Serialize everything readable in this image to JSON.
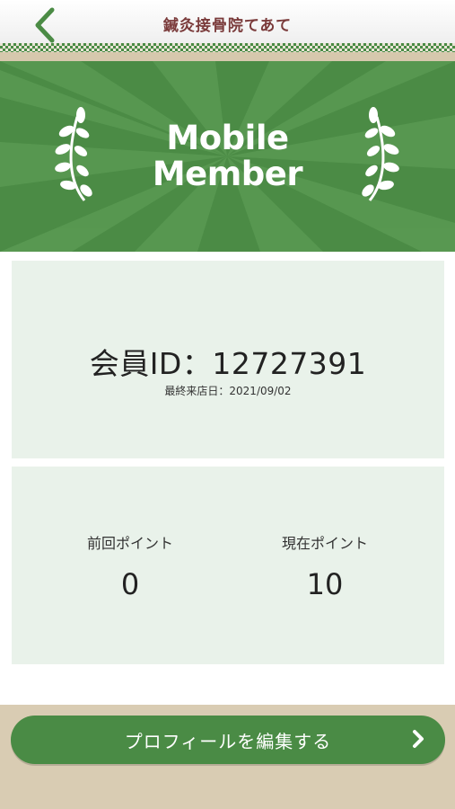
{
  "header": {
    "title": "鍼灸接骨院てあて",
    "back_icon": "chevron-left-icon"
  },
  "banner": {
    "line1": "Mobile",
    "line2": "Member",
    "left_icon": "laurel-icon",
    "right_icon": "laurel-icon"
  },
  "member": {
    "id_text": "会員ID：12727391",
    "last_visit": "最終来店日：2021/09/02"
  },
  "points": {
    "previous_label": "前回ポイント",
    "previous_value": "0",
    "current_label": "現在ポイント",
    "current_value": "10"
  },
  "actions": {
    "edit_profile_label": "プロフィールを編集する",
    "edit_icon": "chevron-right-icon"
  },
  "colors": {
    "accent_green": "#4b8b45",
    "title_brown": "#7a3a3a",
    "card_bg": "#e9f2ea"
  }
}
